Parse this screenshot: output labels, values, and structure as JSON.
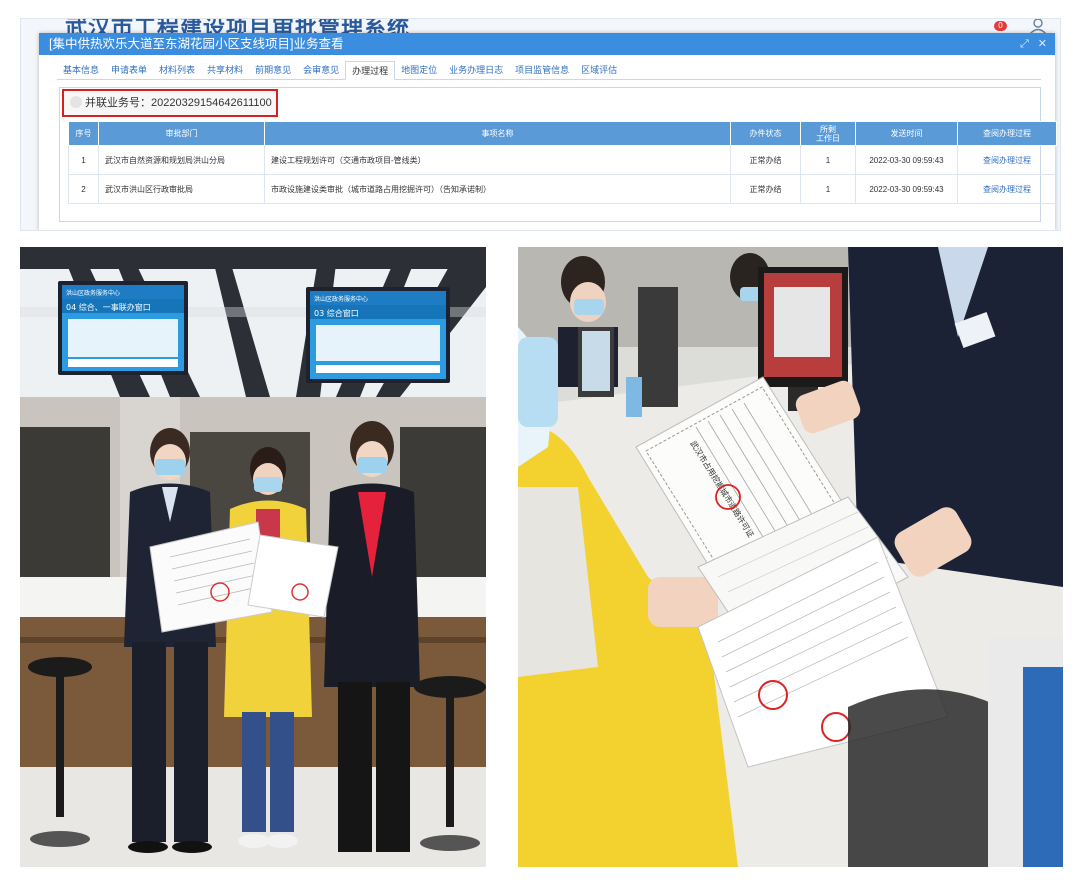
{
  "background_app": {
    "title": "武汉市工程建设项目审批管理系统",
    "badge": "0"
  },
  "dialog": {
    "title": "[集中供热欢乐大道至东湖花园小区支线项目]业务查看",
    "controls": {
      "maximize": "⤢",
      "close": "✕"
    }
  },
  "tabs": [
    {
      "label": "基本信息"
    },
    {
      "label": "申请表单"
    },
    {
      "label": "材料列表"
    },
    {
      "label": "共享材料"
    },
    {
      "label": "前期意见"
    },
    {
      "label": "会审意见"
    },
    {
      "label": "办理过程"
    },
    {
      "label": "地图定位"
    },
    {
      "label": "业务办理日志"
    },
    {
      "label": "项目监管信息"
    },
    {
      "label": "区域评估"
    }
  ],
  "active_tab": "办理过程",
  "business_number": "并联业务号：20220329154642611100",
  "table": {
    "headers": [
      "序号",
      "审批部门",
      "事项名称",
      "办件状态",
      "所剩\n工作日",
      "发送时间",
      "查阅办理过程"
    ],
    "rows": [
      {
        "no": "1",
        "dept": "武汉市自然资源和规划局洪山分局",
        "item": "建设工程规划许可（交通市政项目-管线类）",
        "status": "正常办结",
        "days": "1",
        "time": "2022-03-30 09:59:43",
        "link": "查阅办理过程"
      },
      {
        "no": "2",
        "dept": "武汉市洪山区行政审批局",
        "item": "市政设施建设类审批（城市道路占用挖掘许可）（告知承诺制）",
        "status": "正常办结",
        "days": "1",
        "time": "2022-03-30 09:59:43",
        "link": "查阅办理过程"
      }
    ]
  },
  "photo_left": {
    "screen1": {
      "header": "洪山区政务服务中心",
      "window": "04 综合、一事联办窗口"
    },
    "screen2": {
      "header": "洪山区政务服务中心",
      "window": "03 综合窗口"
    }
  },
  "photo_right": {
    "certificate_title": "武汉市占用挖掘城市道路许可证"
  }
}
